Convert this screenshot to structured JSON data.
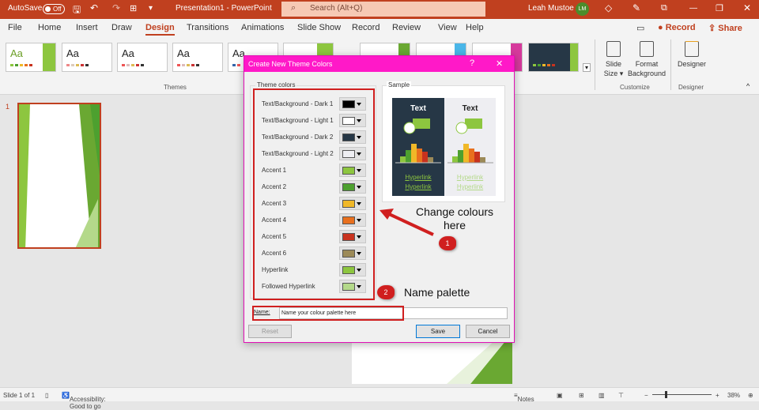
{
  "titlebar": {
    "autosave": "AutoSave",
    "autosave_state": "Off",
    "doc_title": "Presentation1 - PowerPoint",
    "search_placeholder": "Search (Alt+Q)",
    "user": "Leah Mustoe",
    "initials": "LM"
  },
  "menu": {
    "tabs": [
      "File",
      "Home",
      "Insert",
      "Draw",
      "Design",
      "Transitions",
      "Animations",
      "Slide Show",
      "Record",
      "Review",
      "View",
      "Help"
    ],
    "active": "Design",
    "record": "Record",
    "share": "Share"
  },
  "ribbon": {
    "themes_label": "Themes",
    "theme_sample": "Aa",
    "slide_size": "Slide Size",
    "format_background": "Format Background",
    "customize_label": "Customize",
    "designer": "Designer",
    "designer_label": "Designer"
  },
  "thumbnail": {
    "number": "1"
  },
  "dialog": {
    "title": "Create New Theme Colors",
    "help": "?",
    "close": "✕",
    "theme_colors_label": "Theme colors",
    "sample_label": "Sample",
    "colors": [
      {
        "label": "Text/Background - Dark 1",
        "color": "#000000"
      },
      {
        "label": "Text/Background - Light 1",
        "color": "#ffffff"
      },
      {
        "label": "Text/Background - Dark 2",
        "color": "#263746"
      },
      {
        "label": "Text/Background - Light 2",
        "color": "#eeeef2"
      },
      {
        "label": "Accent 1",
        "color": "#8dc63f"
      },
      {
        "label": "Accent 2",
        "color": "#4da02f"
      },
      {
        "label": "Accent 3",
        "color": "#f0b828"
      },
      {
        "label": "Accent 4",
        "color": "#e8701e"
      },
      {
        "label": "Accent 5",
        "color": "#c8321e"
      },
      {
        "label": "Accent 6",
        "color": "#9c8a58"
      },
      {
        "label": "Hyperlink",
        "color": "#8dc63f"
      },
      {
        "label": "Followed Hyperlink",
        "color": "#b4d98a"
      }
    ],
    "sample_text": "Text",
    "sample_hyperlink": "Hyperlink",
    "name_label": "Name:",
    "name_value": "Name your colour palette here",
    "reset": "Reset",
    "save": "Save",
    "cancel": "Cancel"
  },
  "annotations": {
    "badge1": "1",
    "text1": "Change colours here",
    "badge2": "2",
    "text2": "Name palette"
  },
  "statusbar": {
    "slide": "Slide 1 of 1",
    "accessibility": "Accessibility: Good to go",
    "notes": "Notes",
    "zoom": "38%"
  }
}
